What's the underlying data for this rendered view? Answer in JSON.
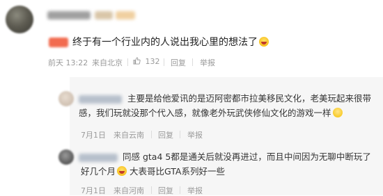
{
  "comment": {
    "text": "终于有一个行业内的人说出我心里的想法了",
    "meta": {
      "time": "前天 13:22",
      "location": "来自北京",
      "likes": "132",
      "reply_label": "回复",
      "report_label": "举报"
    }
  },
  "replies": [
    {
      "text_line1": "主要是给他爱讯的是迈阿密都市拉美移民文化，老美玩起来很带",
      "text_line2": "感，我们玩就没那个代入感，就像老外玩武侠修仙文化的游戏一样",
      "meta": {
        "date": "7月1日",
        "location": "来自云南",
        "reply_label": "回复",
        "report_label": "举报"
      }
    },
    {
      "text_line1": "同感 gta4 5都是通关后就没再进过，而且中间因为无聊中断玩了",
      "text_line2a": "好几个月",
      "text_line2b": " 大表哥比GTA系列好一些",
      "meta": {
        "date": "7月1日",
        "location": "来自河南",
        "reply_label": "回复",
        "report_label": "举报"
      }
    }
  ],
  "colors": {
    "badge": "#f26b4f",
    "meta_text": "#9a9a9a",
    "reply_bg": "#f6f6f6"
  }
}
